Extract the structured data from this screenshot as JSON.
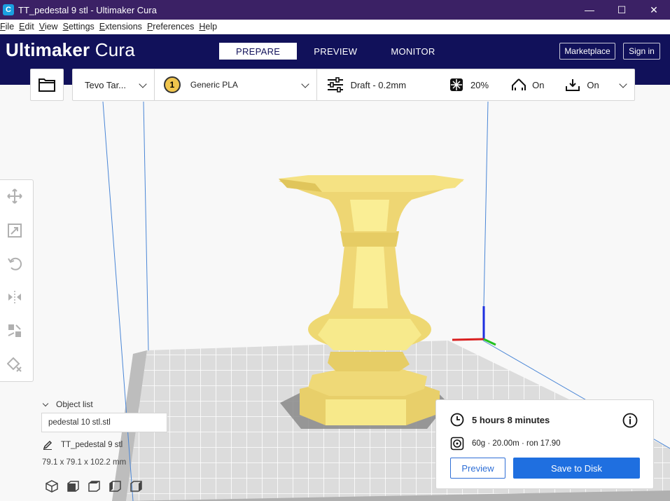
{
  "window": {
    "title": "TT_pedestal 9 stl - Ultimaker Cura",
    "app_icon_letter": "C",
    "minimize": "—",
    "maximize": "☐",
    "close": "✕"
  },
  "menu": [
    {
      "accel": "F",
      "rest": "ile"
    },
    {
      "accel": "E",
      "rest": "dit"
    },
    {
      "accel": "V",
      "rest": "iew"
    },
    {
      "accel": "S",
      "rest": "ettings"
    },
    {
      "accel": "E",
      "rest": "xtensions"
    },
    {
      "accel": "P",
      "rest": "references"
    },
    {
      "accel": "H",
      "rest": "elp"
    }
  ],
  "header": {
    "logo_bold": "Ultimaker",
    "logo_light": " Cura",
    "tabs": [
      {
        "label": "PREPARE",
        "active": true
      },
      {
        "label": "PREVIEW",
        "active": false
      },
      {
        "label": "MONITOR",
        "active": false
      }
    ],
    "marketplace_label": "Marketplace",
    "signin_label": "Sign in"
  },
  "toolbar": {
    "printer": "Tevo Tar...",
    "extruder_number": "1",
    "material": "Generic PLA",
    "profile": "Draft - 0.2mm",
    "infill": "20%",
    "support": "On",
    "adhesion": "On"
  },
  "object_list": {
    "header": "Object list",
    "items": [
      "pedestal 10 stl.stl"
    ],
    "current_object": "TT_pedestal 9 stl",
    "dimensions": "79.1 x 79.1 x 102.2 mm"
  },
  "action_panel": {
    "print_time": "5 hours 8 minutes",
    "material_estimate": "60g · 20.00m · ron 17.90",
    "preview_label": "Preview",
    "save_label": "Save to Disk"
  },
  "colors": {
    "header_bg": "#11115a",
    "titlebar_bg": "#3b2165",
    "accent_blue": "#1f6fe0",
    "model_yellow": "#f2df7e"
  }
}
